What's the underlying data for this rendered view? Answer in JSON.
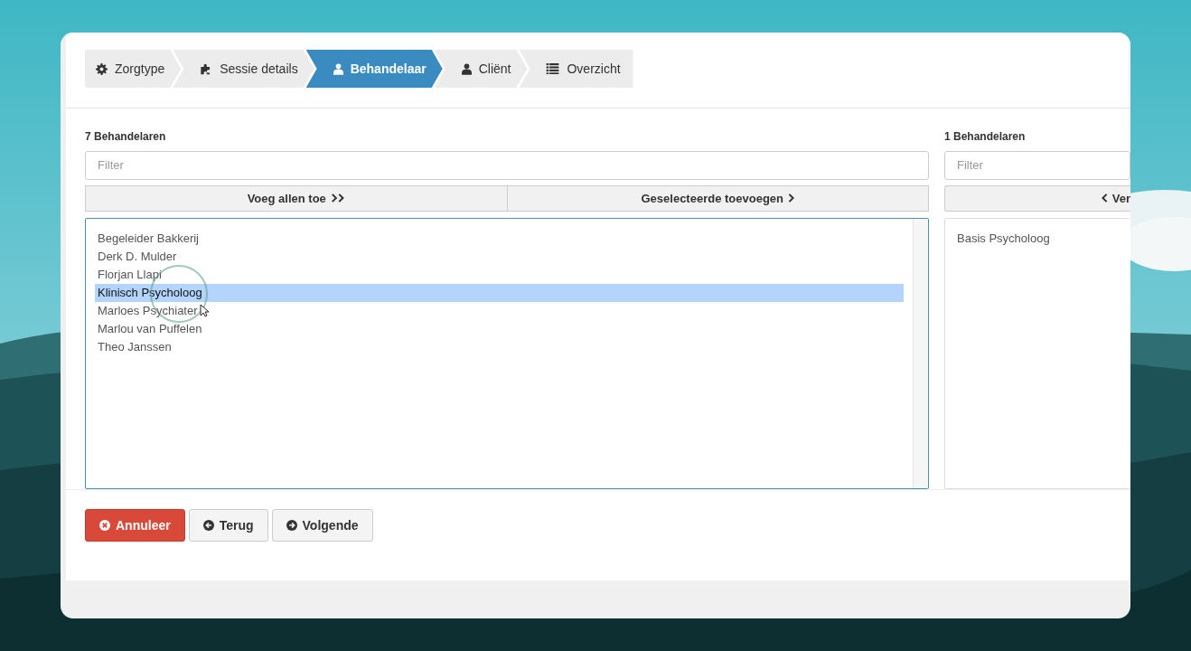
{
  "steps": [
    {
      "label": "Zorgtype",
      "selected": false
    },
    {
      "label": "Sessie details",
      "selected": false
    },
    {
      "label": "Behandelaar",
      "selected": true
    },
    {
      "label": "Cliënt",
      "selected": false
    },
    {
      "label": "Overzicht",
      "selected": false
    }
  ],
  "available": {
    "heading": "7 Behandelaren",
    "filter": {
      "placeholder": "Filter"
    },
    "buttons": [
      {
        "label": "Voeg allen toe"
      },
      {
        "label": "Geselecteerde toevoegen"
      }
    ],
    "items": [
      {
        "label": "Begeleider Bakkerij",
        "selected": false
      },
      {
        "label": "Derk D. Mulder",
        "selected": false
      },
      {
        "label": "Florjan Llapi",
        "selected": false
      },
      {
        "label": "Klinisch Psycholoog",
        "selected": true
      },
      {
        "label": "Marloes Psychiater",
        "selected": false
      },
      {
        "label": "Marlou van Puffelen",
        "selected": false
      },
      {
        "label": "Theo Janssen",
        "selected": false
      }
    ]
  },
  "chosen": {
    "heading": "1 Behandelaren",
    "filter": {
      "placeholder": "Filter"
    },
    "buttons": [
      {
        "label": "Ver"
      }
    ],
    "items": [
      {
        "label": "Basis Psycholoog",
        "selected": false
      }
    ]
  },
  "footer_buttons": [
    {
      "label": "Annuleer",
      "kind": "danger"
    },
    {
      "label": "Terug",
      "kind": "default"
    },
    {
      "label": "Volgende",
      "kind": "default"
    }
  ]
}
